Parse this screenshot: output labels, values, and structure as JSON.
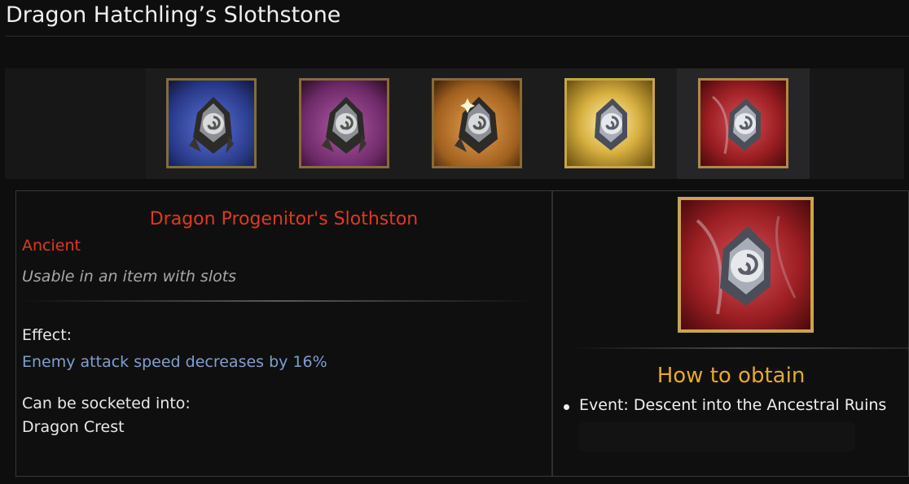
{
  "page": {
    "title": "Dragon Hatchling’s Slothstone"
  },
  "variants": [
    {
      "name": "variant-blue",
      "bg": "#2a3a8a",
      "icon": "slothstone-rough-icon",
      "frame": "bronze"
    },
    {
      "name": "variant-purple",
      "bg": "#7a2e74",
      "icon": "slothstone-rough-icon",
      "frame": "bronze"
    },
    {
      "name": "variant-orange",
      "bg": "#b06a22",
      "icon": "slothstone-rough-sparkle-icon",
      "frame": "bronze"
    },
    {
      "name": "variant-gold",
      "bg": "#c9a232",
      "icon": "slothstone-polished-icon",
      "frame": "gold"
    },
    {
      "name": "variant-red",
      "bg": "#9a1e22",
      "icon": "slothstone-polished-icon",
      "frame": "bronze",
      "selected": true
    }
  ],
  "item": {
    "name": "Dragon Progenitor's Slothston",
    "rarity": "Ancient",
    "usage": "Usable in an item with slots",
    "effect_label": "Effect:",
    "effect_value": "Enemy attack speed decreases by 16%",
    "socket_label": "Can be socketed into:",
    "socket_value": "Dragon Crest"
  },
  "obtain": {
    "title": "How to obtain",
    "items": [
      "Event: Descent into the Ancestral Ruins"
    ]
  },
  "colors": {
    "rarity_ancient": "#e0391d",
    "effect_text": "#7f9fd1",
    "obtain_title": "#e3a92a",
    "frame_gold": "#c9a54a",
    "frame_bronze": "#8a6a3a"
  }
}
